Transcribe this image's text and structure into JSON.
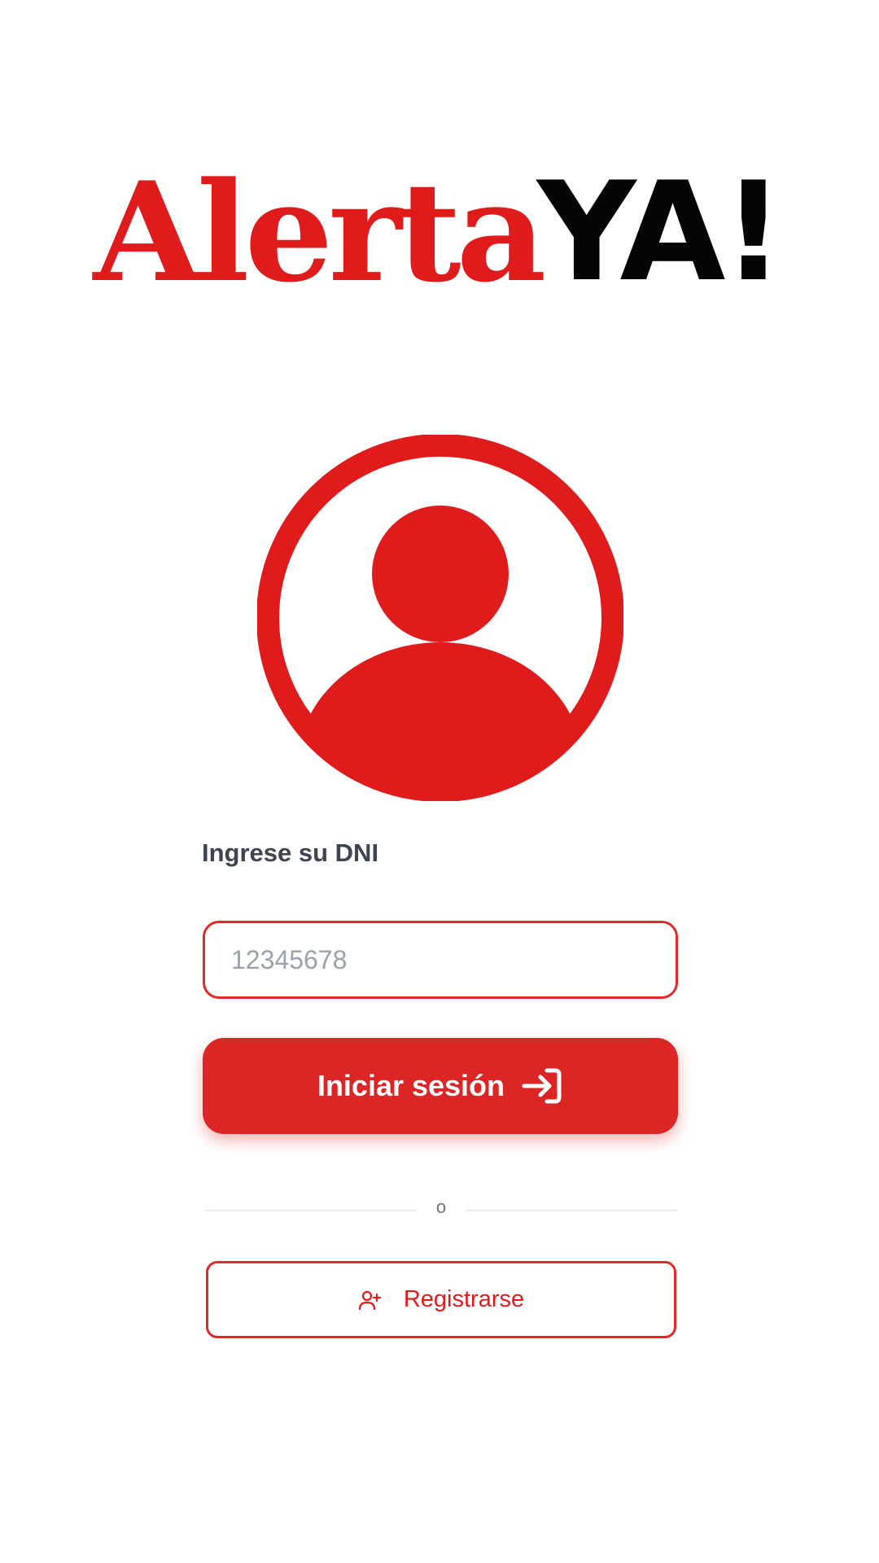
{
  "logo": {
    "word_1": "Alerta",
    "word_2": "YA!",
    "accent_color": "#e01b1b",
    "dark_color": "#050505"
  },
  "avatar": {
    "icon": "user-circle-icon",
    "color": "#e01b1b"
  },
  "form": {
    "dni_label": "Ingrese su DNI",
    "dni_placeholder": "12345678",
    "dni_value": "",
    "login_label": "Iniciar sesión",
    "login_icon": "login-arrow-icon"
  },
  "divider": {
    "text": "o"
  },
  "register": {
    "label": "Registrarse",
    "icon": "user-plus-icon"
  },
  "colors": {
    "primary": "#dc2626",
    "label_text": "#3d4452",
    "placeholder": "#9aa2ae"
  }
}
